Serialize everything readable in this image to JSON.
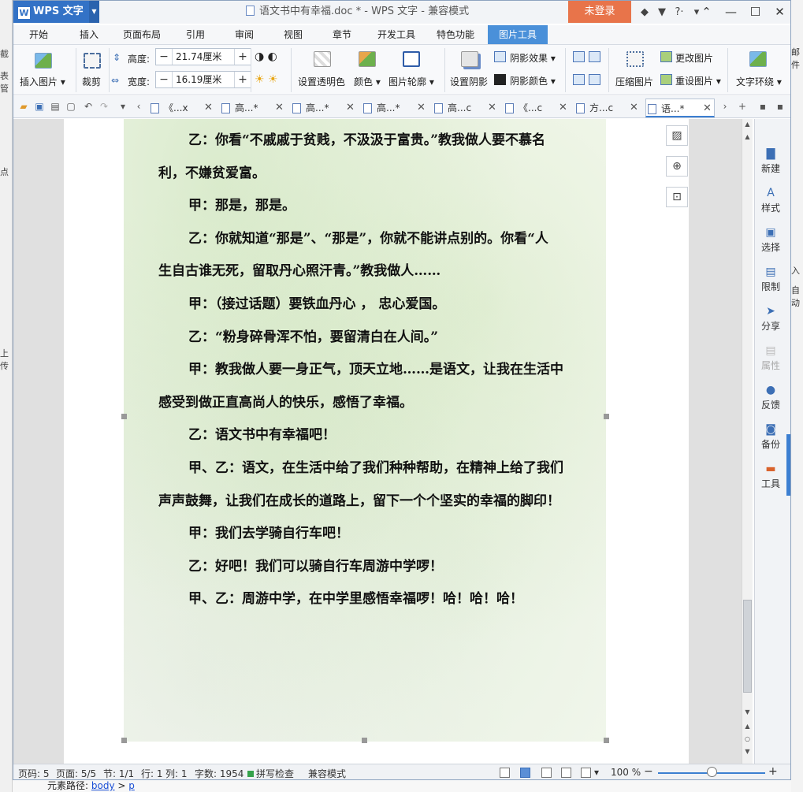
{
  "window": {
    "app_name": "WPS 文字",
    "app_logo": "W",
    "title": "语文书中有幸福.doc * - WPS 文字 - 兼容模式",
    "login_label": "未登录",
    "controls": [
      "minimize-icon",
      "maximize-icon",
      "close-icon"
    ]
  },
  "menu": {
    "tabs": [
      "开始",
      "插入",
      "页面布局",
      "引用",
      "审阅",
      "视图",
      "章节",
      "开发工具",
      "特色功能",
      "图片工具"
    ],
    "active": "图片工具"
  },
  "ribbon": {
    "insert_picture": "插入图片",
    "crop": "裁剪",
    "height_label": "高度:",
    "height_value": "21.74厘米",
    "width_label": "宽度:",
    "width_value": "16.19厘米",
    "set_transparent": "设置透明色",
    "color": "颜色",
    "outline": "图片轮廓",
    "set_shadow": "设置阴影",
    "shadow_effect": "阴影效果",
    "shadow_color": "阴影颜色",
    "compress": "压缩图片",
    "change_picture": "更改图片",
    "reset_picture": "重设图片",
    "text_wrap": "文字环绕"
  },
  "tabs": [
    {
      "label": "《...x"
    },
    {
      "label": "高...*"
    },
    {
      "label": "高...*"
    },
    {
      "label": "高...*"
    },
    {
      "label": "高...c"
    },
    {
      "label": "《...c"
    },
    {
      "label": "方...c"
    },
    {
      "label": "语...*"
    }
  ],
  "document": {
    "lines": [
      {
        "text": "乙：你看“不戚戚于贫贱，不汲汲于富贵。”教我做人要不慕名",
        "indent": true
      },
      {
        "text": "利，不嫌贫爱富。",
        "indent": false
      },
      {
        "text": "甲：那是，那是。",
        "indent": true
      },
      {
        "text": "乙：你就知道“那是”、“那是”，你就不能讲点别的。你看“人",
        "indent": true
      },
      {
        "text": "生自古谁无死，留取丹心照汗青。”教我做人……",
        "indent": false
      },
      {
        "text": "甲：（接过话题）要铁血丹心 ， 忠心爱国。",
        "indent": true
      },
      {
        "text": "乙：“粉身碎骨浑不怕，要留清白在人间。”",
        "indent": true
      },
      {
        "text": "甲：教我做人要一身正气，顶天立地……是语文，让我在生活中",
        "indent": true
      },
      {
        "text": "感受到做正直高尚人的快乐，感悟了幸福。",
        "indent": false
      },
      {
        "text": "乙：语文书中有幸福吧！",
        "indent": true
      },
      {
        "text": "甲、乙：语文，在生活中给了我们种种帮助，在精神上给了我们",
        "indent": true
      },
      {
        "text": "声声鼓舞，让我们在成长的道路上，留下一个个坚实的幸福的脚印！",
        "indent": false
      },
      {
        "text": "甲：我们去学骑自行车吧！",
        "indent": true
      },
      {
        "text": "乙：好吧！我们可以骑自行车周游中学啰！",
        "indent": true
      },
      {
        "text": "甲、乙：周游中学，在中学里感悟幸福啰！哈！哈！哈！",
        "indent": true
      }
    ]
  },
  "right_panel": [
    {
      "label": "新建",
      "icon": "new-doc-icon",
      "glyph": "▇",
      "disabled": false
    },
    {
      "label": "样式",
      "icon": "style-icon",
      "glyph": "A",
      "disabled": false
    },
    {
      "label": "选择",
      "icon": "select-icon",
      "glyph": "▣",
      "disabled": false
    },
    {
      "label": "限制",
      "icon": "restrict-icon",
      "glyph": "▤",
      "disabled": false
    },
    {
      "label": "分享",
      "icon": "share-icon",
      "glyph": "➤",
      "disabled": false
    },
    {
      "label": "属性",
      "icon": "properties-icon",
      "glyph": "▤",
      "disabled": true
    },
    {
      "label": "反馈",
      "icon": "feedback-icon",
      "glyph": "●",
      "disabled": false
    },
    {
      "label": "备份",
      "icon": "backup-icon",
      "glyph": "◙",
      "disabled": false
    },
    {
      "label": "工具",
      "icon": "toolbox-icon",
      "glyph": "▬",
      "disabled": false
    }
  ],
  "status": {
    "page_code": "页码: 5",
    "pages": "页面: 5/5",
    "section": "节: 1/1",
    "row": "行: 1",
    "col": "列: 1",
    "word_count": "字数: 1954",
    "spell_check": "拼写检查",
    "compat_mode": "兼容模式",
    "zoom": "100 %"
  },
  "background_app": {
    "element_path_label": "元素路径:",
    "element_path_body": "body",
    "element_path_p": "p",
    "left_fragments": [
      "截",
      "表管",
      "点",
      "上传"
    ],
    "right_fragments": [
      "邮件",
      "入",
      "自动"
    ]
  },
  "colors": {
    "accent": "#3c7fd1",
    "app_button": "#3372c6",
    "login": "#e8744a"
  }
}
